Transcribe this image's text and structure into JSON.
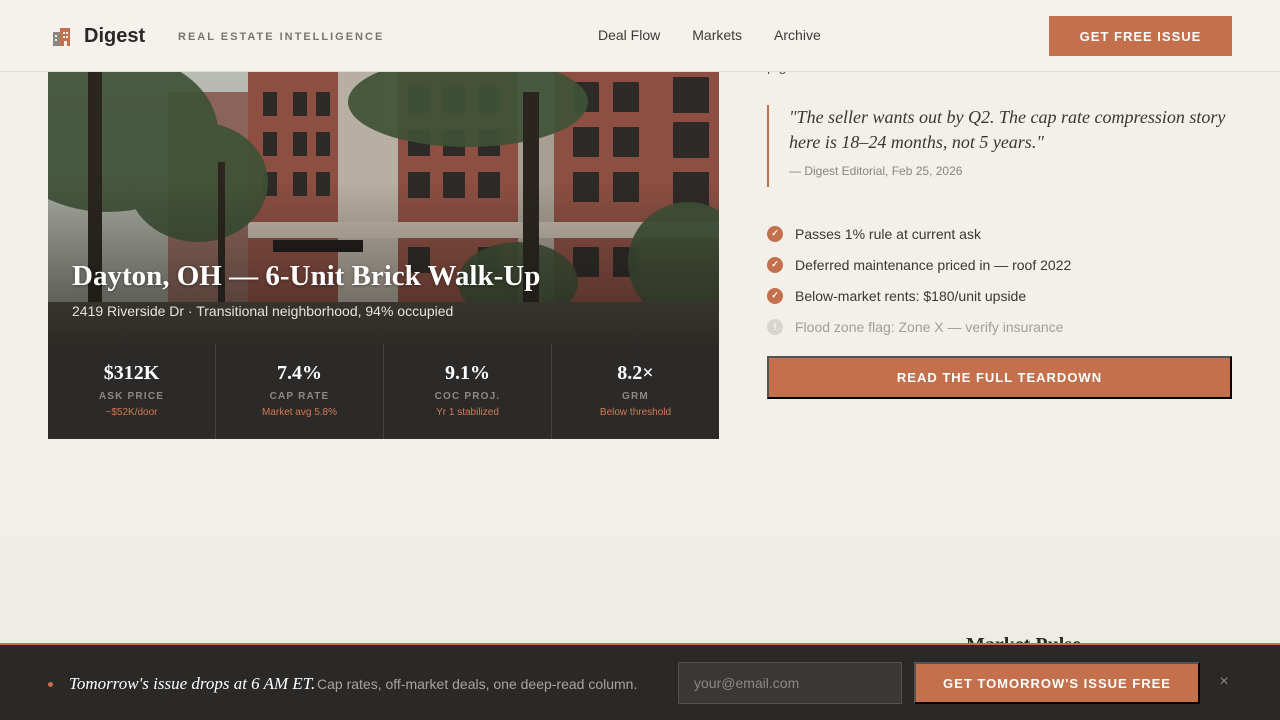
{
  "header": {
    "brand": "Digest",
    "tagline": "REAL ESTATE INTELLIGENCE",
    "nav": [
      "Deal Flow",
      "Markets",
      "Archive"
    ],
    "cta": "GET FREE ISSUE"
  },
  "hero": {
    "title": "Dayton, OH — 6-Unit Brick Walk-Up",
    "subtitle": "2419 Riverside Dr · Transitional neighborhood, 94% occupied",
    "stats": [
      {
        "value": "$312K",
        "label": "ASK PRICE",
        "note": "~$52K/door"
      },
      {
        "value": "7.4%",
        "label": "CAP RATE",
        "note": "Market avg 5.8%"
      },
      {
        "value": "9.1%",
        "label": "COC PROJ.",
        "note": "Yr 1 stabilized"
      },
      {
        "value": "8.2×",
        "label": "GRM",
        "note": "Below threshold"
      }
    ]
  },
  "article": {
    "clipped_text": "p   g",
    "quote": "\"The seller wants out by Q2. The cap rate compression story here is 18–24 months, not 5 years.\"",
    "attribution": "— Digest Editorial, Feb 25, 2026",
    "checks": [
      {
        "text": "Passes 1% rule at current ask",
        "status": "pass"
      },
      {
        "text": "Deferred maintenance priced in — roof 2022",
        "status": "pass"
      },
      {
        "text": "Below-market rents: $180/unit upside",
        "status": "pass"
      },
      {
        "text": "Flood zone flag: Zone X — verify insurance",
        "status": "warn"
      }
    ],
    "cta": "READ THE FULL TEARDOWN"
  },
  "lower": {
    "heading_peek": "Market Pulse"
  },
  "sticky": {
    "title": "Tomorrow's issue drops at 6 AM ET.",
    "description": "Cap rates, off-market deals, one deep-read column.",
    "email_placeholder": "your@email.com",
    "cta": "GET TOMORROW'S ISSUE FREE",
    "close": "×"
  },
  "colors": {
    "accent": "#c5704d",
    "dark": "#2b2927",
    "background": "#f3efe9"
  }
}
